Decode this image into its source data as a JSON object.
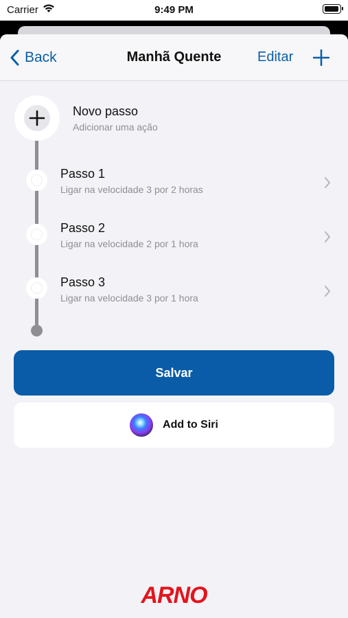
{
  "status_bar": {
    "carrier": "Carrier",
    "time": "9:49 PM",
    "wifi_icon": "wifi-icon",
    "battery_icon": "battery-icon"
  },
  "nav": {
    "back_label": "Back",
    "title": "Manhã Quente",
    "edit_label": "Editar",
    "add_icon": "plus-icon"
  },
  "new_step": {
    "title": "Novo passo",
    "subtitle": "Adicionar uma ação"
  },
  "steps": [
    {
      "title": "Passo 1",
      "subtitle": "Ligar na velocidade 3 por 2 horas"
    },
    {
      "title": "Passo 2",
      "subtitle": "Ligar na velocidade 2 por 1 hora"
    },
    {
      "title": "Passo 3",
      "subtitle": "Ligar na velocidade 3 por 1 hora"
    }
  ],
  "buttons": {
    "save_label": "Salvar",
    "siri_label": "Add to Siri"
  },
  "brand": {
    "logo_text": "ARNO"
  },
  "colors": {
    "accent": "#0a5ca8",
    "brand_red": "#e3141b",
    "background": "#f2f2f7"
  }
}
